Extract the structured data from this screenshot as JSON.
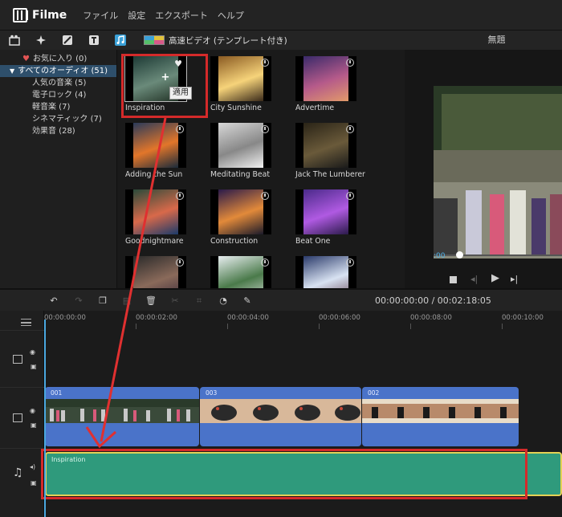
{
  "app": {
    "name": "Filme",
    "menu": [
      "ファイル",
      "設定",
      "エクスポート",
      "ヘルプ"
    ]
  },
  "toolbar": {
    "icons": [
      "media-icon",
      "effects-icon",
      "transition-icon",
      "text-icon",
      "music-icon"
    ],
    "hd_label": "高速ビデオ (テンプレート付き)"
  },
  "categories": {
    "favorites": "お気に入り (0)",
    "all_audio": "すべてのオーディオ (51)",
    "items": [
      "人気の音楽 (5)",
      "電子ロック (4)",
      "軽音楽 (7)",
      "シネマティック (7)",
      "効果音 (28)"
    ]
  },
  "media": {
    "tiles": [
      {
        "name": "Inspiration",
        "colors": [
          "#1d3a35",
          "#6a8a7a",
          "#233427"
        ]
      },
      {
        "name": "City Sunshine",
        "colors": [
          "#8a5a22",
          "#f6d37a",
          "#3a2a1a"
        ]
      },
      {
        "name": "Advertime",
        "colors": [
          "#3a2a6a",
          "#b55a8a",
          "#e29a6a"
        ]
      },
      {
        "name": "Adding the Sun",
        "colors": [
          "#2a3a5a",
          "#e2762a",
          "#1a2a3a"
        ]
      },
      {
        "name": "Meditating Beat",
        "colors": [
          "#d8d8d8",
          "#888888",
          "#f2f2f2"
        ]
      },
      {
        "name": "Jack The Lumberer",
        "colors": [
          "#2a2417",
          "#6a5a3a",
          "#1a1a1a"
        ]
      },
      {
        "name": "Goodnightmare",
        "colors": [
          "#2a4a3a",
          "#d8694a",
          "#1a3a6a"
        ]
      },
      {
        "name": "Construction",
        "colors": [
          "#2a1a4a",
          "#e28a3a",
          "#1a1a2a"
        ]
      },
      {
        "name": "Beat One",
        "colors": [
          "#4a2a8a",
          "#b05ae2",
          "#2a1a4a"
        ]
      },
      {
        "name": "",
        "colors": [
          "#2a2a2a",
          "#8a6a5a",
          "#3a2a3a"
        ]
      },
      {
        "name": "",
        "colors": [
          "#e8eef0",
          "#4a7a4a",
          "#cfd8d0"
        ]
      },
      {
        "name": "",
        "colors": [
          "#2a3a6a",
          "#d8e2f2",
          "#6a4a5a"
        ]
      }
    ],
    "tooltip": "適用"
  },
  "preview": {
    "title": "無題",
    "time_small": ":00"
  },
  "timeline": {
    "timecode": "00:00:00:00 / 00:02:18:05",
    "ruler": [
      "00:00:00:00",
      "00:00:02:00",
      "00:00:04:00",
      "00:00:06:00",
      "00:00:08:00",
      "00:00:10:00"
    ],
    "clips": [
      {
        "label": "001"
      },
      {
        "label": "003"
      },
      {
        "label": "002"
      }
    ],
    "audio_label": "Inspiration"
  }
}
